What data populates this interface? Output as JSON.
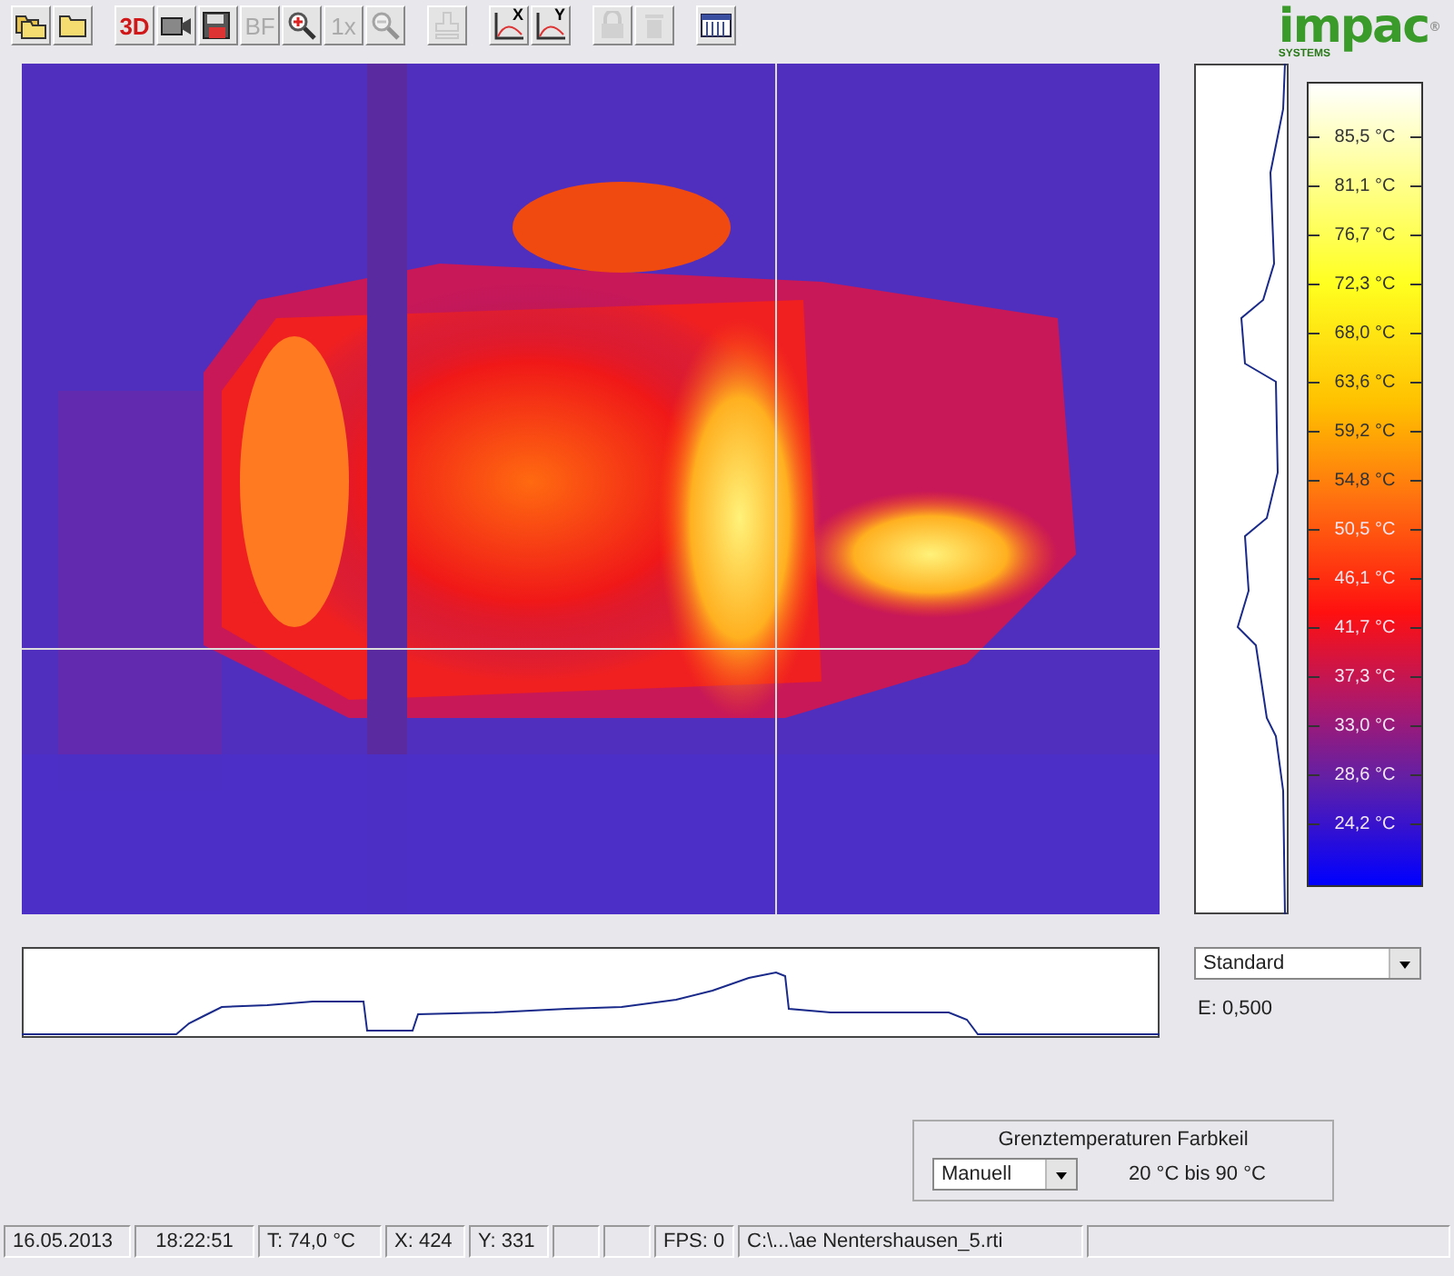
{
  "toolbar": [
    [
      {
        "kind": "folders",
        "disabled": false
      },
      {
        "kind": "folder",
        "disabled": false
      }
    ],
    [
      {
        "kind": "text",
        "label": "3D",
        "disabled": false
      },
      {
        "kind": "camera",
        "disabled": false
      },
      {
        "kind": "save",
        "disabled": false
      },
      {
        "kind": "text",
        "label": "BF",
        "disabled": true
      },
      {
        "kind": "zoom-in",
        "disabled": false
      },
      {
        "kind": "text",
        "label": "1x",
        "disabled": true
      },
      {
        "kind": "zoom-out",
        "disabled": true
      }
    ],
    [
      {
        "kind": "stamp",
        "disabled": true
      }
    ],
    [
      {
        "kind": "axis",
        "label": "X",
        "disabled": false
      },
      {
        "kind": "axis",
        "label": "Y",
        "disabled": false
      }
    ],
    [
      {
        "kind": "lock",
        "disabled": true
      },
      {
        "kind": "trash",
        "disabled": true
      }
    ],
    [
      {
        "kind": "grid",
        "disabled": false
      }
    ]
  ],
  "logo": {
    "name": "impac",
    "sub": "SYSTEMS",
    "mark": "®"
  },
  "scale": {
    "labels": [
      "85,5 °C",
      "81,1 °C",
      "76,7 °C",
      "72,3 °C",
      "68,0 °C",
      "63,6 °C",
      "59,2 °C",
      "54,8 °C",
      "50,5 °C",
      "46,1 °C",
      "41,7 °C",
      "37,3 °C",
      "33,0 °C",
      "28,6 °C",
      "24,2 °C"
    ]
  },
  "palette": {
    "value": "Standard"
  },
  "emissivity": "E:  0,500",
  "limits": {
    "title": "Grenztemperaturen Farbkeil",
    "mode": "Manuell",
    "range": "20 °C bis 90 °C"
  },
  "status_bar": [
    {
      "kind": "text",
      "text": "16.05.2013"
    },
    {
      "kind": "text",
      "text": "18:22:51"
    },
    {
      "kind": "text",
      "text": "T:   74,0 °C"
    },
    {
      "kind": "text",
      "text": "X: 424"
    },
    {
      "kind": "text",
      "text": "Y: 331"
    },
    {
      "kind": "blank"
    },
    {
      "kind": "blank"
    },
    {
      "kind": "text",
      "text": "FPS: 0"
    },
    {
      "kind": "text",
      "text": "C:\\...\\ae Nentershausen_5.rti"
    },
    {
      "kind": "blank"
    }
  ]
}
